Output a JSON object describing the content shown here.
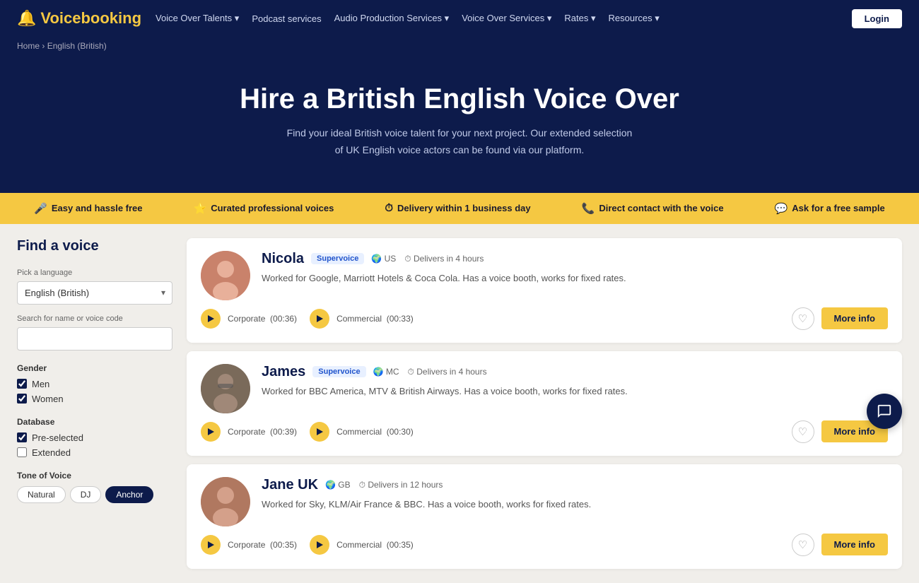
{
  "nav": {
    "logo_text": "Voicebooking",
    "logo_icon": "🔔",
    "links": [
      {
        "label": "Voice Over Talents",
        "has_chevron": true
      },
      {
        "label": "Podcast services",
        "has_chevron": false
      },
      {
        "label": "Audio Production Services",
        "has_chevron": true
      },
      {
        "label": "Voice Over Services",
        "has_chevron": true
      },
      {
        "label": "Rates",
        "has_chevron": true
      },
      {
        "label": "Resources",
        "has_chevron": true
      }
    ],
    "login_label": "Login"
  },
  "breadcrumb": {
    "home": "Home",
    "separator": "›",
    "current": "English (British)"
  },
  "hero": {
    "title_part1": "Hire a British English",
    "title_part2": "Voice Over",
    "description": "Find your ideal British voice talent for your next project. Our extended selection of UK English voice actors can be found via our platform."
  },
  "badges": [
    {
      "icon": "🎤",
      "label": "Easy and hassle free"
    },
    {
      "icon": "⭐",
      "label": "Curated professional voices"
    },
    {
      "icon": "⏱",
      "label": "Delivery within 1 business day"
    },
    {
      "icon": "📞",
      "label": "Direct contact with the voice"
    },
    {
      "icon": "💬",
      "label": "Ask for a free sample"
    }
  ],
  "sidebar": {
    "title": "Find a voice",
    "language_label": "Pick a language",
    "language_value": "English (British)",
    "search_label": "Search for name or voice code",
    "search_placeholder": "",
    "gender_label": "Gender",
    "genders": [
      {
        "label": "Men",
        "checked": true
      },
      {
        "label": "Women",
        "checked": true
      }
    ],
    "database_label": "Database",
    "databases": [
      {
        "label": "Pre-selected",
        "checked": true
      },
      {
        "label": "Extended",
        "checked": false
      }
    ],
    "tone_label": "Tone of Voice",
    "tones": [
      {
        "label": "Natural",
        "active": false
      },
      {
        "label": "DJ",
        "active": false
      },
      {
        "label": "Anchor",
        "active": true
      }
    ]
  },
  "voices": [
    {
      "id": "nicola",
      "name": "Nicola",
      "badge": "Supervoice",
      "country": "US",
      "delivery": "Delivers in 4 hours",
      "description": "Worked for Google, Marriott Hotels & Coca Cola. Has a voice booth, works for fixed rates.",
      "samples": [
        {
          "type": "Corporate",
          "duration": "00:36"
        },
        {
          "type": "Commercial",
          "duration": "00:33"
        }
      ],
      "more_info": "More info"
    },
    {
      "id": "james",
      "name": "James",
      "badge": "Supervoice",
      "country": "MC",
      "delivery": "Delivers in 4 hours",
      "description": "Worked for BBC America, MTV & British Airways. Has a voice booth, works for fixed rates.",
      "samples": [
        {
          "type": "Corporate",
          "duration": "00:39"
        },
        {
          "type": "Commercial",
          "duration": "00:30"
        }
      ],
      "more_info": "More info"
    },
    {
      "id": "jane-uk",
      "name": "Jane UK",
      "badge": "",
      "country": "GB",
      "delivery": "Delivers in 12 hours",
      "description": "Worked for Sky, KLM/Air France & BBC. Has a voice booth, works for fixed rates.",
      "samples": [
        {
          "type": "Corporate",
          "duration": "00:35"
        },
        {
          "type": "Commercial",
          "duration": "00:35"
        }
      ],
      "more_info": "More info"
    }
  ]
}
